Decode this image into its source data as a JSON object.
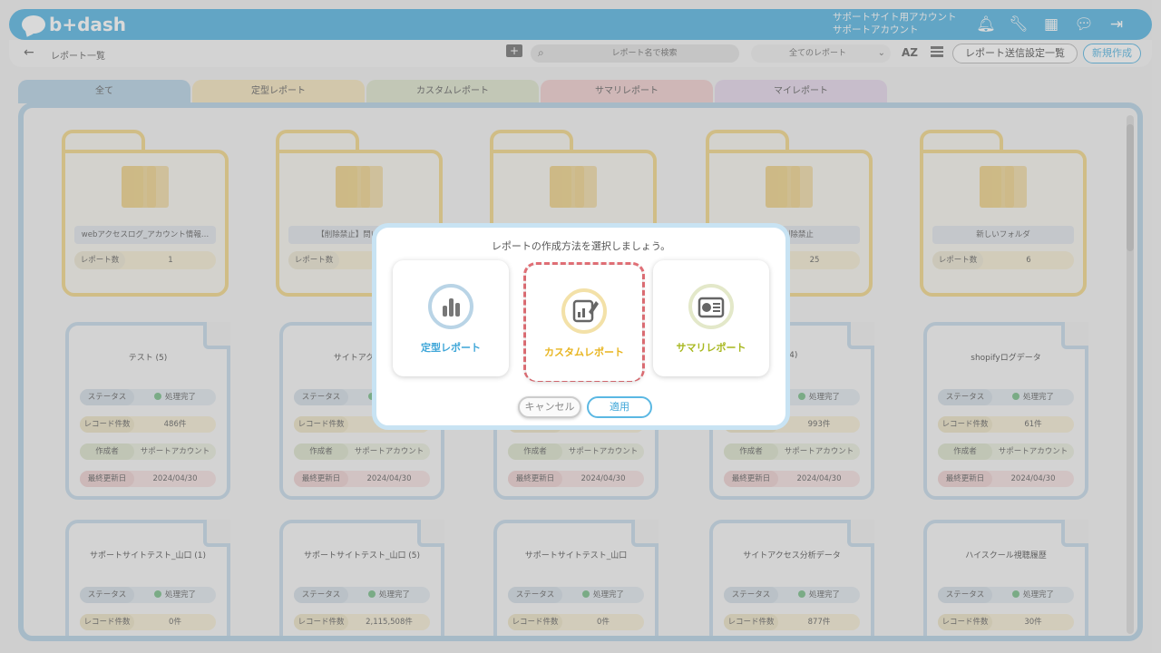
{
  "header": {
    "logo": "b+dash",
    "account_line1": "サポートサイト用アカウント",
    "account_line2": "サポートアカウント",
    "icons": [
      "bell-icon",
      "wrench-icon",
      "grid-icon",
      "chat-icon",
      "logout-icon"
    ]
  },
  "toolbar": {
    "back": "←",
    "breadcrumb": "レポート一覧",
    "search_placeholder": "レポート名で検索",
    "filter_value": "全てのレポート",
    "sort_label": "AZ",
    "send_settings_label": "レポート送信設定一覧",
    "new_label": "新規作成"
  },
  "tabs": [
    {
      "label": "全て",
      "color": "#b9d4e6"
    },
    {
      "label": "定型レポート",
      "color": "#f5e6bf"
    },
    {
      "label": "カスタムレポート",
      "color": "#dfe6cf"
    },
    {
      "label": "サマリレポート",
      "color": "#f2d0d0"
    },
    {
      "label": "マイレポート",
      "color": "#e6d9ec"
    }
  ],
  "folders": [
    {
      "name": "webアクセスログ_アカウント情報…",
      "count_label": "レポート数",
      "count": "1"
    },
    {
      "name": "【削除禁止】問い合わせ",
      "count_label": "レポート数",
      "count": ""
    },
    {
      "name": "",
      "count_label": "レポート数",
      "count": ""
    },
    {
      "name": "編集/削除禁止",
      "count_label": "レポート数",
      "count": "25"
    },
    {
      "name": "新しいフォルダ",
      "count_label": "レポート数",
      "count": "6"
    }
  ],
  "labels": {
    "status": "ステータス",
    "records": "レコード件数",
    "author": "作成者",
    "updated": "最終更新日",
    "done": "処理完了"
  },
  "reports_row1": [
    {
      "title": "テスト (5)",
      "records": "486件",
      "author": "サポートアカウント",
      "updated": "2024/04/30"
    },
    {
      "title": "サイトアクセス",
      "records": "",
      "author": "サポートアカウント",
      "updated": "2024/04/30"
    },
    {
      "title": "",
      "records": "",
      "author": "サポートアカウント",
      "updated": "2024/04/30"
    },
    {
      "title": "(4)",
      "records": "993件",
      "author": "サポートアカウント",
      "updated": "2024/04/30"
    },
    {
      "title": "shopifyログデータ",
      "records": "61件",
      "author": "サポートアカウント",
      "updated": "2024/04/30"
    }
  ],
  "reports_row2": [
    {
      "title": "サポートサイトテスト_山口 (1)",
      "records": "0件"
    },
    {
      "title": "サポートサイトテスト_山口 (5)",
      "records": "2,115,508件"
    },
    {
      "title": "サポートサイトテスト_山口",
      "records": "0件"
    },
    {
      "title": "サイトアクセス分析データ",
      "records": "877件"
    },
    {
      "title": "ハイスクール視聴履歴",
      "records": "30件"
    }
  ],
  "modal": {
    "title": "レポートの作成方法を選択しましょう。",
    "options": [
      {
        "label": "定型レポート",
        "color": "#3ea6d8"
      },
      {
        "label": "カスタムレポート",
        "color": "#e8b520"
      },
      {
        "label": "サマリレポート",
        "color": "#a8b820"
      }
    ],
    "cancel_label": "キャンセル",
    "apply_label": "適用"
  }
}
